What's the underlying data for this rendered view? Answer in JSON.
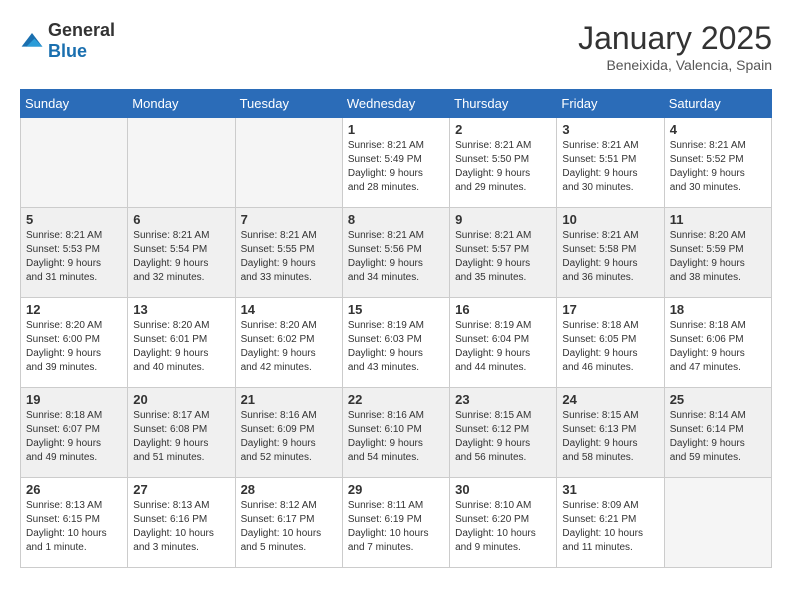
{
  "logo": {
    "general": "General",
    "blue": "Blue"
  },
  "title": "January 2025",
  "location": "Beneixida, Valencia, Spain",
  "weekdays": [
    "Sunday",
    "Monday",
    "Tuesday",
    "Wednesday",
    "Thursday",
    "Friday",
    "Saturday"
  ],
  "weeks": [
    [
      {
        "day": "",
        "info": ""
      },
      {
        "day": "",
        "info": ""
      },
      {
        "day": "",
        "info": ""
      },
      {
        "day": "1",
        "info": "Sunrise: 8:21 AM\nSunset: 5:49 PM\nDaylight: 9 hours\nand 28 minutes."
      },
      {
        "day": "2",
        "info": "Sunrise: 8:21 AM\nSunset: 5:50 PM\nDaylight: 9 hours\nand 29 minutes."
      },
      {
        "day": "3",
        "info": "Sunrise: 8:21 AM\nSunset: 5:51 PM\nDaylight: 9 hours\nand 30 minutes."
      },
      {
        "day": "4",
        "info": "Sunrise: 8:21 AM\nSunset: 5:52 PM\nDaylight: 9 hours\nand 30 minutes."
      }
    ],
    [
      {
        "day": "5",
        "info": "Sunrise: 8:21 AM\nSunset: 5:53 PM\nDaylight: 9 hours\nand 31 minutes."
      },
      {
        "day": "6",
        "info": "Sunrise: 8:21 AM\nSunset: 5:54 PM\nDaylight: 9 hours\nand 32 minutes."
      },
      {
        "day": "7",
        "info": "Sunrise: 8:21 AM\nSunset: 5:55 PM\nDaylight: 9 hours\nand 33 minutes."
      },
      {
        "day": "8",
        "info": "Sunrise: 8:21 AM\nSunset: 5:56 PM\nDaylight: 9 hours\nand 34 minutes."
      },
      {
        "day": "9",
        "info": "Sunrise: 8:21 AM\nSunset: 5:57 PM\nDaylight: 9 hours\nand 35 minutes."
      },
      {
        "day": "10",
        "info": "Sunrise: 8:21 AM\nSunset: 5:58 PM\nDaylight: 9 hours\nand 36 minutes."
      },
      {
        "day": "11",
        "info": "Sunrise: 8:20 AM\nSunset: 5:59 PM\nDaylight: 9 hours\nand 38 minutes."
      }
    ],
    [
      {
        "day": "12",
        "info": "Sunrise: 8:20 AM\nSunset: 6:00 PM\nDaylight: 9 hours\nand 39 minutes."
      },
      {
        "day": "13",
        "info": "Sunrise: 8:20 AM\nSunset: 6:01 PM\nDaylight: 9 hours\nand 40 minutes."
      },
      {
        "day": "14",
        "info": "Sunrise: 8:20 AM\nSunset: 6:02 PM\nDaylight: 9 hours\nand 42 minutes."
      },
      {
        "day": "15",
        "info": "Sunrise: 8:19 AM\nSunset: 6:03 PM\nDaylight: 9 hours\nand 43 minutes."
      },
      {
        "day": "16",
        "info": "Sunrise: 8:19 AM\nSunset: 6:04 PM\nDaylight: 9 hours\nand 44 minutes."
      },
      {
        "day": "17",
        "info": "Sunrise: 8:18 AM\nSunset: 6:05 PM\nDaylight: 9 hours\nand 46 minutes."
      },
      {
        "day": "18",
        "info": "Sunrise: 8:18 AM\nSunset: 6:06 PM\nDaylight: 9 hours\nand 47 minutes."
      }
    ],
    [
      {
        "day": "19",
        "info": "Sunrise: 8:18 AM\nSunset: 6:07 PM\nDaylight: 9 hours\nand 49 minutes."
      },
      {
        "day": "20",
        "info": "Sunrise: 8:17 AM\nSunset: 6:08 PM\nDaylight: 9 hours\nand 51 minutes."
      },
      {
        "day": "21",
        "info": "Sunrise: 8:16 AM\nSunset: 6:09 PM\nDaylight: 9 hours\nand 52 minutes."
      },
      {
        "day": "22",
        "info": "Sunrise: 8:16 AM\nSunset: 6:10 PM\nDaylight: 9 hours\nand 54 minutes."
      },
      {
        "day": "23",
        "info": "Sunrise: 8:15 AM\nSunset: 6:12 PM\nDaylight: 9 hours\nand 56 minutes."
      },
      {
        "day": "24",
        "info": "Sunrise: 8:15 AM\nSunset: 6:13 PM\nDaylight: 9 hours\nand 58 minutes."
      },
      {
        "day": "25",
        "info": "Sunrise: 8:14 AM\nSunset: 6:14 PM\nDaylight: 9 hours\nand 59 minutes."
      }
    ],
    [
      {
        "day": "26",
        "info": "Sunrise: 8:13 AM\nSunset: 6:15 PM\nDaylight: 10 hours\nand 1 minute."
      },
      {
        "day": "27",
        "info": "Sunrise: 8:13 AM\nSunset: 6:16 PM\nDaylight: 10 hours\nand 3 minutes."
      },
      {
        "day": "28",
        "info": "Sunrise: 8:12 AM\nSunset: 6:17 PM\nDaylight: 10 hours\nand 5 minutes."
      },
      {
        "day": "29",
        "info": "Sunrise: 8:11 AM\nSunset: 6:19 PM\nDaylight: 10 hours\nand 7 minutes."
      },
      {
        "day": "30",
        "info": "Sunrise: 8:10 AM\nSunset: 6:20 PM\nDaylight: 10 hours\nand 9 minutes."
      },
      {
        "day": "31",
        "info": "Sunrise: 8:09 AM\nSunset: 6:21 PM\nDaylight: 10 hours\nand 11 minutes."
      },
      {
        "day": "",
        "info": ""
      }
    ]
  ]
}
